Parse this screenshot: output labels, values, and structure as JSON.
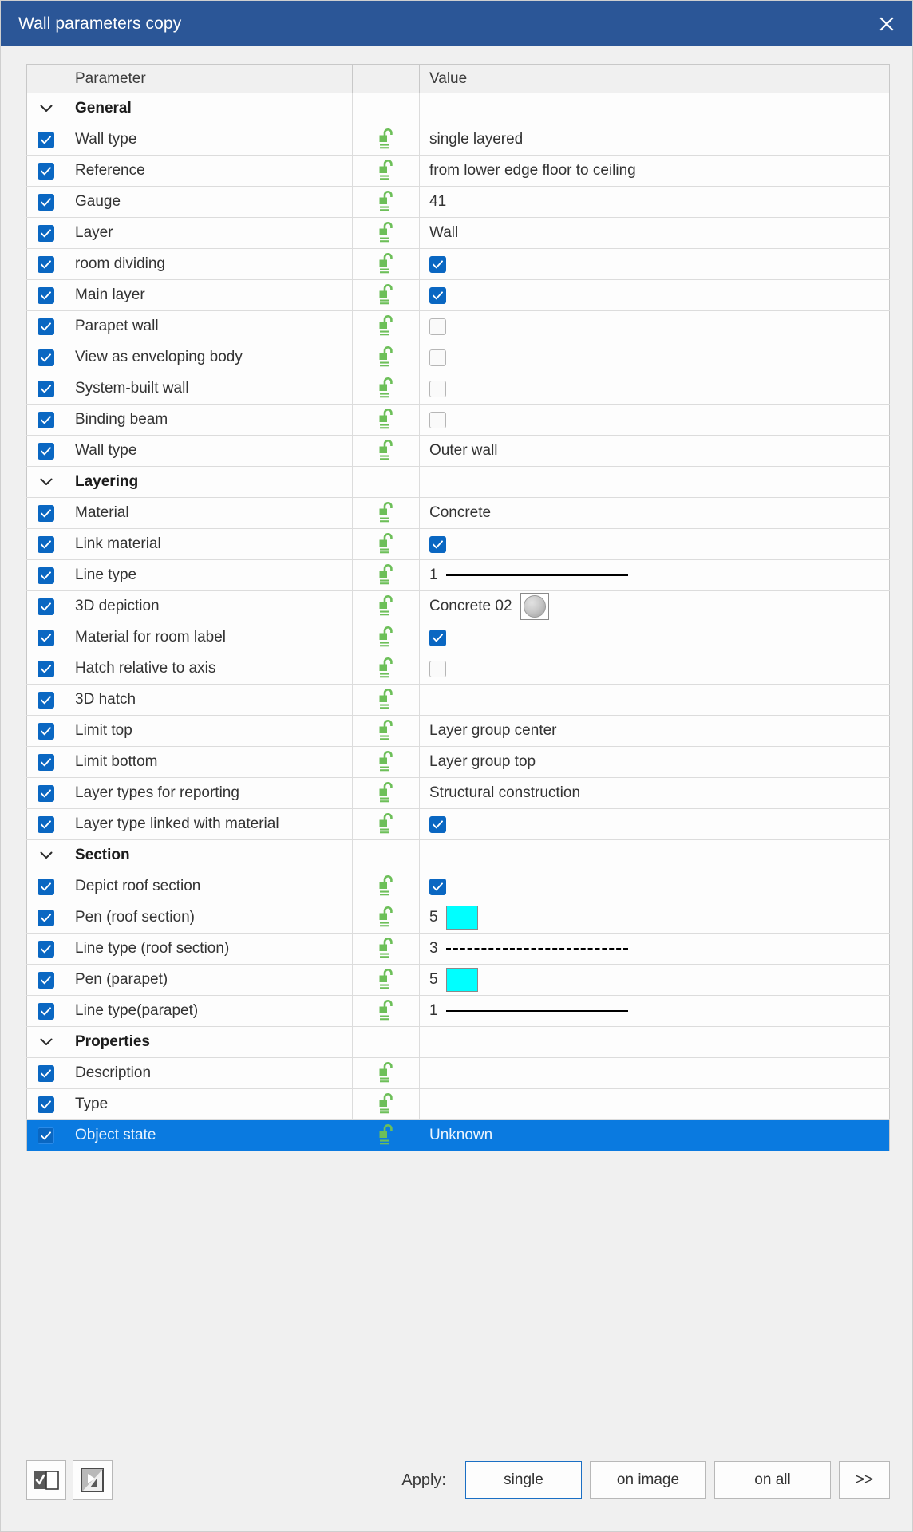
{
  "window": {
    "title": "Wall parameters copy",
    "close_icon": "close-icon",
    "accent_titlebar": "#2b5697",
    "accent_selection": "#0a7ae0",
    "accent_checkbox": "#0a67c2",
    "accent_lock": "#6dbf59"
  },
  "table": {
    "headers": {
      "check": "",
      "parameter": "Parameter",
      "lock": "",
      "value": "Value"
    },
    "rows": [
      {
        "kind": "group",
        "label": "General",
        "chevron": "chevron-down-icon"
      },
      {
        "kind": "row",
        "checked": true,
        "label": "Wall type",
        "lock": "unlock-icon",
        "value_type": "text",
        "value": "single layered"
      },
      {
        "kind": "row",
        "checked": true,
        "label": "Reference",
        "lock": "unlock-icon",
        "value_type": "text",
        "value": "from lower edge floor to ceiling"
      },
      {
        "kind": "row",
        "checked": true,
        "label": "Gauge",
        "lock": "unlock-icon",
        "value_type": "text",
        "value": "41"
      },
      {
        "kind": "row",
        "checked": true,
        "label": "Layer",
        "lock": "unlock-icon",
        "value_type": "text",
        "value": "Wall"
      },
      {
        "kind": "row",
        "checked": true,
        "label": "room dividing",
        "lock": "unlock-icon",
        "value_type": "checkbox",
        "value_checked": true
      },
      {
        "kind": "row",
        "checked": true,
        "label": "Main layer",
        "lock": "unlock-icon",
        "value_type": "checkbox",
        "value_checked": true
      },
      {
        "kind": "row",
        "checked": true,
        "label": "Parapet wall",
        "lock": "unlock-icon",
        "value_type": "checkbox",
        "value_checked": false
      },
      {
        "kind": "row",
        "checked": true,
        "label": "View as enveloping body",
        "lock": "unlock-icon",
        "value_type": "checkbox",
        "value_checked": false
      },
      {
        "kind": "row",
        "checked": true,
        "label": "System-built wall",
        "lock": "unlock-icon",
        "value_type": "checkbox",
        "value_checked": false
      },
      {
        "kind": "row",
        "checked": true,
        "label": "Binding beam",
        "lock": "unlock-icon",
        "value_type": "checkbox",
        "value_checked": false
      },
      {
        "kind": "row",
        "checked": true,
        "label": "Wall type",
        "lock": "unlock-icon",
        "value_type": "text",
        "value": "Outer wall"
      },
      {
        "kind": "group",
        "label": "Layering",
        "chevron": "chevron-down-icon"
      },
      {
        "kind": "row",
        "checked": true,
        "label": "Material",
        "lock": "unlock-icon",
        "value_type": "text",
        "value": "Concrete"
      },
      {
        "kind": "row",
        "checked": true,
        "label": "Link material",
        "lock": "unlock-icon",
        "value_type": "checkbox",
        "value_checked": true
      },
      {
        "kind": "row",
        "checked": true,
        "label": "Line type",
        "lock": "unlock-icon",
        "value_type": "linestyle",
        "value": "1",
        "line": "solid"
      },
      {
        "kind": "row",
        "checked": true,
        "label": "3D depiction",
        "lock": "unlock-icon",
        "value_type": "material",
        "value": "Concrete 02",
        "swatch": "material-sphere-preview"
      },
      {
        "kind": "row",
        "checked": true,
        "label": "Material for room label",
        "lock": "unlock-icon",
        "value_type": "checkbox",
        "value_checked": true
      },
      {
        "kind": "row",
        "checked": true,
        "label": "Hatch relative to axis",
        "lock": "unlock-icon",
        "value_type": "checkbox",
        "value_checked": false
      },
      {
        "kind": "row",
        "checked": true,
        "label": "3D hatch",
        "lock": "unlock-icon",
        "value_type": "text",
        "value": ""
      },
      {
        "kind": "row",
        "checked": true,
        "label": "Limit top",
        "lock": "unlock-icon",
        "value_type": "text",
        "value": "Layer group center"
      },
      {
        "kind": "row",
        "checked": true,
        "label": "Limit bottom",
        "lock": "unlock-icon",
        "value_type": "text",
        "value": "Layer group top"
      },
      {
        "kind": "row",
        "checked": true,
        "label": "Layer types for reporting",
        "lock": "unlock-icon",
        "value_type": "text",
        "value": "Structural construction"
      },
      {
        "kind": "row",
        "checked": true,
        "label": "Layer type linked with material",
        "lock": "unlock-icon",
        "value_type": "checkbox",
        "value_checked": true
      },
      {
        "kind": "group",
        "label": "Section",
        "chevron": "chevron-down-icon"
      },
      {
        "kind": "row",
        "checked": true,
        "label": "Depict roof section",
        "lock": "unlock-icon",
        "value_type": "checkbox",
        "value_checked": true
      },
      {
        "kind": "row",
        "checked": true,
        "label": "Pen (roof section)",
        "lock": "unlock-icon",
        "value_type": "pen",
        "value": "5",
        "color": "#00ffff"
      },
      {
        "kind": "row",
        "checked": true,
        "label": "Line type (roof section)",
        "lock": "unlock-icon",
        "value_type": "linestyle",
        "value": "3",
        "line": "dashed"
      },
      {
        "kind": "row",
        "checked": true,
        "label": "Pen (parapet)",
        "lock": "unlock-icon",
        "value_type": "pen",
        "value": "5",
        "color": "#00ffff"
      },
      {
        "kind": "row",
        "checked": true,
        "label": "Line type(parapet)",
        "lock": "unlock-icon",
        "value_type": "linestyle",
        "value": "1",
        "line": "solid"
      },
      {
        "kind": "group",
        "label": "Properties",
        "chevron": "chevron-down-icon"
      },
      {
        "kind": "row",
        "checked": true,
        "label": "Description",
        "lock": "unlock-icon",
        "value_type": "text",
        "value": ""
      },
      {
        "kind": "row",
        "checked": true,
        "label": "Type",
        "lock": "unlock-icon",
        "value_type": "text",
        "value": ""
      },
      {
        "kind": "row",
        "checked": true,
        "selected": true,
        "label": "Object state",
        "lock": "unlock-icon",
        "value_type": "text",
        "value": "Unknown"
      }
    ]
  },
  "bottom": {
    "toggle_all_icon": "select-all-checkbox-icon",
    "invert_icon": "invert-selection-icon",
    "apply_label": "Apply:",
    "buttons": [
      {
        "label": "single",
        "primary": true,
        "name": "apply-single-button"
      },
      {
        "label": "on image",
        "primary": false,
        "name": "apply-on-image-button"
      },
      {
        "label": "on all",
        "primary": false,
        "name": "apply-on-all-button"
      },
      {
        "label": ">>",
        "primary": false,
        "name": "more-options-button",
        "narrow": true
      }
    ]
  }
}
